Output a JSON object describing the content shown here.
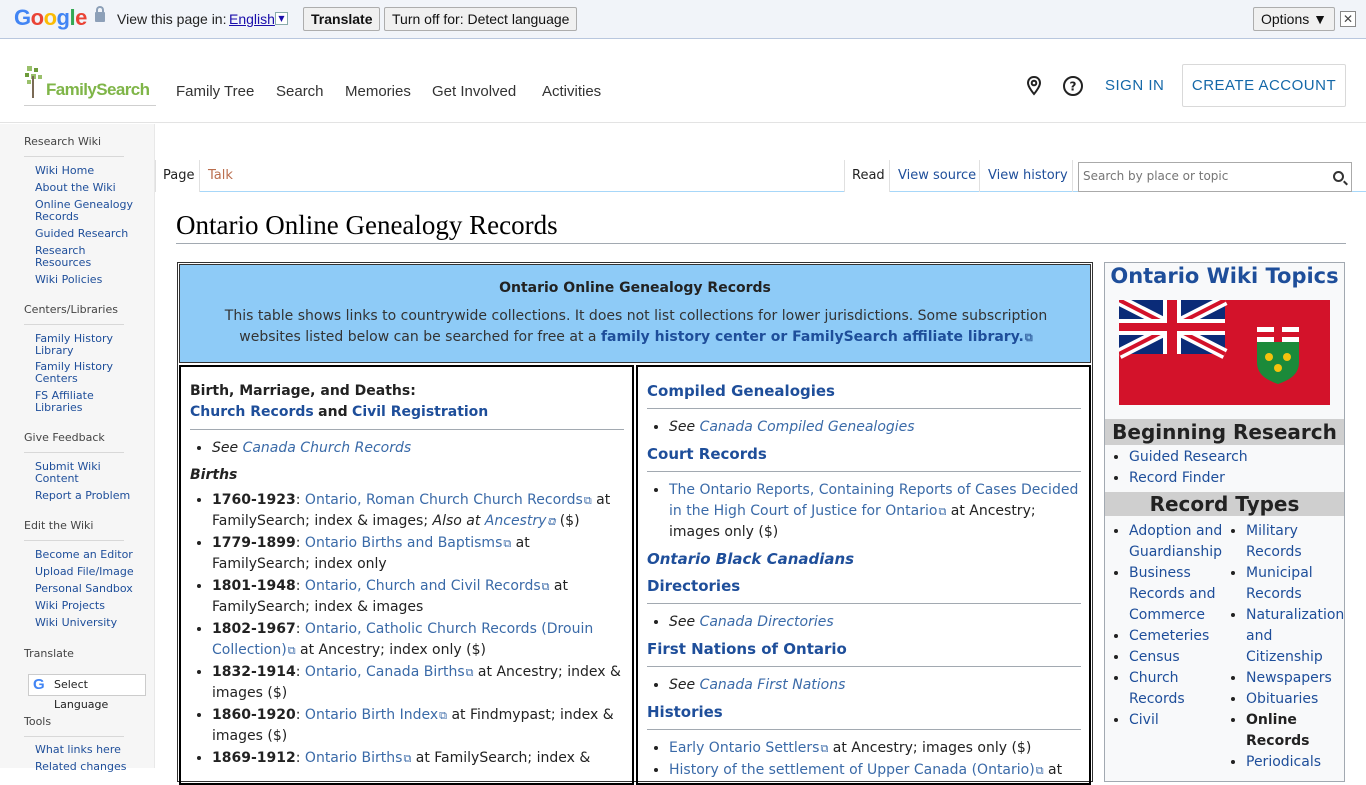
{
  "translate_bar": {
    "brand": "Google",
    "view_in": "View this page in:",
    "language": "English",
    "translate_btn": "Translate",
    "turn_off_btn": "Turn off for: Detect language",
    "options_btn": "Options ▼",
    "close": "✕"
  },
  "header": {
    "logo_text": "FamilySearch",
    "nav": [
      "Family Tree",
      "Search",
      "Memories",
      "Get Involved",
      "Activities"
    ],
    "sign_in": "SIGN IN",
    "create_account": "CREATE ACCOUNT"
  },
  "sidebar": {
    "sections": [
      {
        "title": "Research Wiki",
        "items": [
          "Wiki Home",
          "About the Wiki",
          "Online Genealogy Records",
          "Guided Research",
          "Research Resources",
          "Wiki Policies"
        ]
      },
      {
        "title": "Centers/Libraries",
        "items": [
          "Family History Library",
          "Family History Centers",
          "FS Affiliate Libraries"
        ]
      },
      {
        "title": "Give Feedback",
        "items": [
          "Submit Wiki Content",
          "Report a Problem"
        ]
      },
      {
        "title": "Edit the Wiki",
        "items": [
          "Become an Editor",
          "Upload File/Image",
          "Personal Sandbox",
          "Wiki Projects",
          "Wiki University"
        ]
      },
      {
        "title": "Translate",
        "items": []
      },
      {
        "title": "Tools",
        "items": [
          "What links here",
          "Related changes"
        ]
      }
    ],
    "select_language": "Select Language"
  },
  "tabs": {
    "page": "Page",
    "talk": "Talk",
    "read": "Read",
    "view_source": "View source",
    "view_history": "View history",
    "search_placeholder": "Search by place or topic"
  },
  "page_title": "Ontario Online Genealogy Records",
  "table": {
    "title": "Ontario Online Genealogy Records",
    "desc": "This table shows links to countrywide collections. It does not list collections for lower jurisdictions. Some subscription websites listed below can be searched for free at a",
    "desc_link": "family history center or FamilySearch affiliate library.",
    "left": {
      "bmd_heading": "Birth, Marriage, and Deaths:",
      "church_records": "Church Records",
      "and": "and",
      "civil_registration": "Civil Registration",
      "see": "See",
      "canada_church": "Canada Church Records",
      "births_heading": "Births",
      "births": [
        {
          "years": "1760-1923",
          "link": "Ontario, Roman Church Church Records",
          "rest": " at FamilySearch; index & images; ",
          "also": "Also at ",
          "also_link": "Ancestry",
          "tail": " ($)"
        },
        {
          "years": "1779-1899",
          "link": "Ontario Births and Baptisms",
          "rest": " at FamilySearch; index only"
        },
        {
          "years": "1801-1948",
          "link": "Ontario, Church and Civil Records",
          "rest": " at FamilySearch; index & images"
        },
        {
          "years": "1802-1967",
          "link": "Ontario, Catholic Church Records (Drouin Collection)",
          "rest": " at Ancestry; index only ($)"
        },
        {
          "years": "1832-1914",
          "link": "Ontario, Canada Births",
          "rest": " at Ancestry; index & images ($)"
        },
        {
          "years": "1860-1920",
          "link": "Ontario Birth Index",
          "rest": " at Findmypast; index & images ($)"
        },
        {
          "years": "1869-1912",
          "link": "Ontario Births",
          "rest": " at FamilySearch; index &"
        }
      ]
    },
    "right": {
      "compiled": "Compiled Genealogies",
      "see": "See",
      "canada_compiled": "Canada Compiled Genealogies",
      "court": "Court Records",
      "court_link": "The Ontario Reports, Containing Reports of Cases Decided in the High Court of Justice for Ontario",
      "court_rest": " at Ancestry; images only ($)",
      "black": "Ontario Black Canadians",
      "directories": "Directories",
      "canada_directories": "Canada Directories",
      "first_nations": "First Nations of Ontario",
      "canada_first_nations": "Canada First Nations",
      "histories": "Histories",
      "hist1_link": "Early Ontario Settlers",
      "hist1_rest": " at Ancestry; images only ($)",
      "hist2_link": "History of the settlement of Upper Canada (Ontario)",
      "hist2_rest": " at"
    }
  },
  "topics": {
    "title": "Ontario Wiki Topics",
    "beginning": "Beginning Research",
    "beginning_items": [
      "Guided Research",
      "Record Finder"
    ],
    "record_types": "Record Types",
    "col1": [
      "Adoption and Guardianship",
      "Business Records and Commerce",
      "Cemeteries",
      "Census",
      "Church Records",
      "Civil"
    ],
    "col2": [
      "Military Records",
      "Municipal Records",
      "Naturalization and Citizenship",
      "Newspapers",
      "Obituaries",
      "Online Records",
      "Periodicals"
    ]
  }
}
